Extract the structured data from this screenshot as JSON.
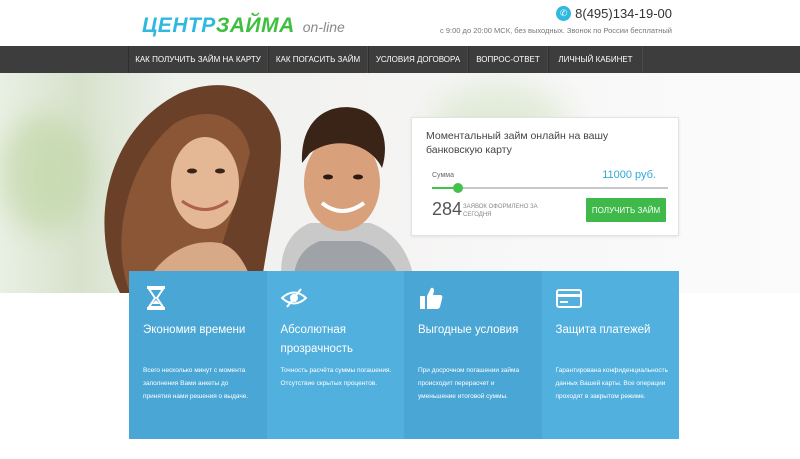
{
  "header": {
    "logo_part1": "ЦЕНТР",
    "logo_part2": "ЗАЙМА",
    "logo_part3": "on-line",
    "phone": "8(495)134-19-00",
    "hours": "с 9:00 до 20:00 МСК, без выходных. Звонок по России бесплатный"
  },
  "nav": {
    "items": [
      {
        "label": "КАК ПОЛУЧИТЬ ЗАЙМ НА КАРТУ"
      },
      {
        "label": "КАК ПОГАСИТЬ ЗАЙМ"
      },
      {
        "label": "УСЛОВИЯ ДОГОВОРА"
      },
      {
        "label": "ВОПРОС-ОТВЕТ"
      },
      {
        "label": "ЛИЧНЫЙ КАБИНЕТ"
      }
    ]
  },
  "loan_panel": {
    "title": "Моментальный займ онлайн на вашу банковскую карту",
    "sum_label": "Сумма",
    "sum_value": "11000 руб.",
    "slider_fraction": 0.11,
    "requests_count": "284",
    "requests_label": "ЗАЯВОК ОФОРМЛЕНО ЗА СЕГОДНЯ",
    "apply_label": "ПОЛУЧИТЬ ЗАЙМ"
  },
  "features": [
    {
      "icon": "hourglass-icon",
      "title": "Экономия времени",
      "desc": "Всего несколько минут с момента заполнения Вами анкеты до принятия нами решения о выдаче.",
      "color": "#4aa7d5"
    },
    {
      "icon": "eye-icon",
      "title": "Абсолютная прозрачность",
      "desc": "Точность расчёта суммы погашения. Отсутствие скрытых процентов.",
      "color": "#52b0de"
    },
    {
      "icon": "thumbs-up-icon",
      "title": "Выгодные условия",
      "desc": "При досрочном погашении займа происходит перерасчет и уменьшение итоговой суммы.",
      "color": "#4aa7d5"
    },
    {
      "icon": "credit-card-icon",
      "title": "Защита платежей",
      "desc": "Гарантирована конфиденциальность данных Вашей карты. Все операции проходят в закрытом режиме.",
      "color": "#52b0de"
    }
  ],
  "colors": {
    "accent_blue": "#2fb8e0",
    "accent_green": "#3fb94a",
    "nav_bg": "#3d3d3d"
  }
}
